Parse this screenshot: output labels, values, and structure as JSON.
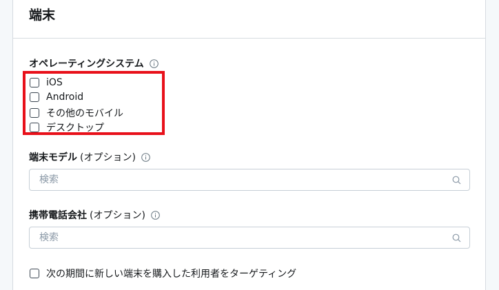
{
  "card": {
    "title": "端末"
  },
  "os_section": {
    "label": "オペレーティングシステム",
    "options": [
      "iOS",
      "Android",
      "その他のモバイル",
      "デスクトップ"
    ]
  },
  "device_model": {
    "label": "端末モデル",
    "optional": "(オプション)",
    "placeholder": "検索"
  },
  "carrier": {
    "label": "携帯電話会社",
    "optional": "(オプション)",
    "placeholder": "検索"
  },
  "new_device": {
    "label": "次の期間に新しい端末を購入した利用者をターゲティング"
  },
  "colors": {
    "highlight": "#e8101a",
    "border": "#d6dbe0"
  }
}
